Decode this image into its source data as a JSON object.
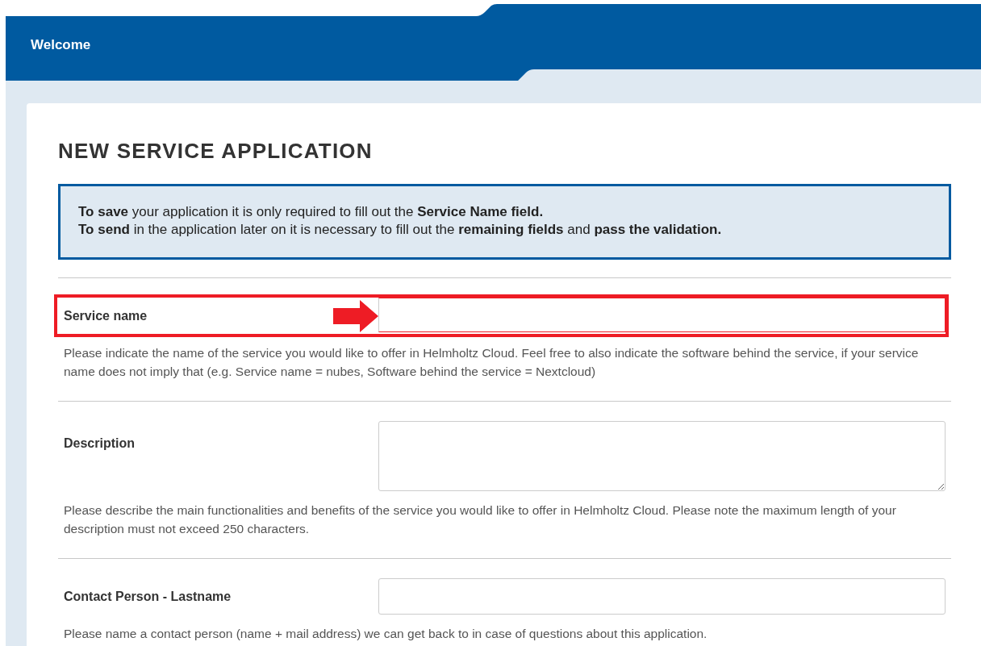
{
  "header": {
    "title": "Welcome"
  },
  "page_title": "NEW SERVICE APPLICATION",
  "info": {
    "lines": [
      "**To save** your application it is only required to fill out the **Service Name field.**",
      "**To send** in the application later on it is necessary to fill out the **remaining fields** and **pass the validation.**"
    ]
  },
  "fields": [
    {
      "label": "Service name",
      "kind": "text",
      "highlighted": true,
      "help": "Please indicate the name of the service you would like to offer in Helmholtz Cloud. Feel free to also indicate the software behind the service, if your service name does not imply that (e.g. Service name = nubes, Software behind the service = Nextcloud)"
    },
    {
      "label": "Description",
      "kind": "textarea",
      "highlighted": false,
      "help": "Please describe the main functionalities and benefits of the service you would like to offer in Helmholtz Cloud. Please note the maximum length of your description must not exceed 250 characters."
    },
    {
      "label": "Contact Person - Lastname",
      "kind": "text",
      "highlighted": false,
      "help": "Please name a contact person (name + mail address) we can get back to in case of questions about this application."
    }
  ]
}
